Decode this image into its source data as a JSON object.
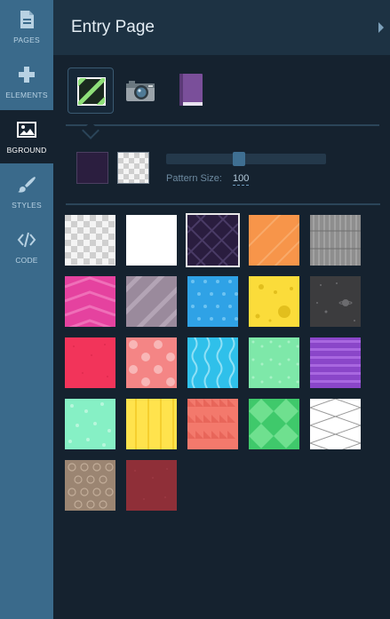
{
  "sidebar": {
    "items": [
      {
        "label": "PAGES",
        "icon": "document-icon",
        "active": false
      },
      {
        "label": "ELEMENTS",
        "icon": "plus-icon",
        "active": false
      },
      {
        "label": "BGROUND",
        "icon": "image-icon",
        "active": true
      },
      {
        "label": "STYLES",
        "icon": "brush-icon",
        "active": false
      },
      {
        "label": "CODE",
        "icon": "code-icon",
        "active": false
      }
    ]
  },
  "header": {
    "title": "Entry Page"
  },
  "background_types": [
    {
      "icon": "pattern-icon",
      "selected": true
    },
    {
      "icon": "camera-icon",
      "selected": false
    },
    {
      "icon": "book-icon",
      "selected": false
    }
  ],
  "colors": {
    "foreground": "#2b1e3f",
    "background": "transparent"
  },
  "pattern_size": {
    "label": "Pattern Size:",
    "value": "100",
    "level": 0.45
  },
  "patterns": [
    "checker-transparent",
    "plain-white",
    "purple-diamonds",
    "orange-diagonal-stripes",
    "gray-vertical-lines",
    "pink-chevrons",
    "mauve-diagonal-stripes",
    "blue-dots",
    "yellow-cheese",
    "dark-space",
    "red-texture",
    "pink-polka-dots",
    "cyan-waves",
    "mint-dots",
    "purple-horizontal-stripes",
    "mint-confetti",
    "yellow-vertical-stripes",
    "salmon-triangles",
    "green-diamonds",
    "white-crosshatch",
    "tan-circles",
    "maroon-texture"
  ],
  "selected_pattern": "purple-diamonds"
}
